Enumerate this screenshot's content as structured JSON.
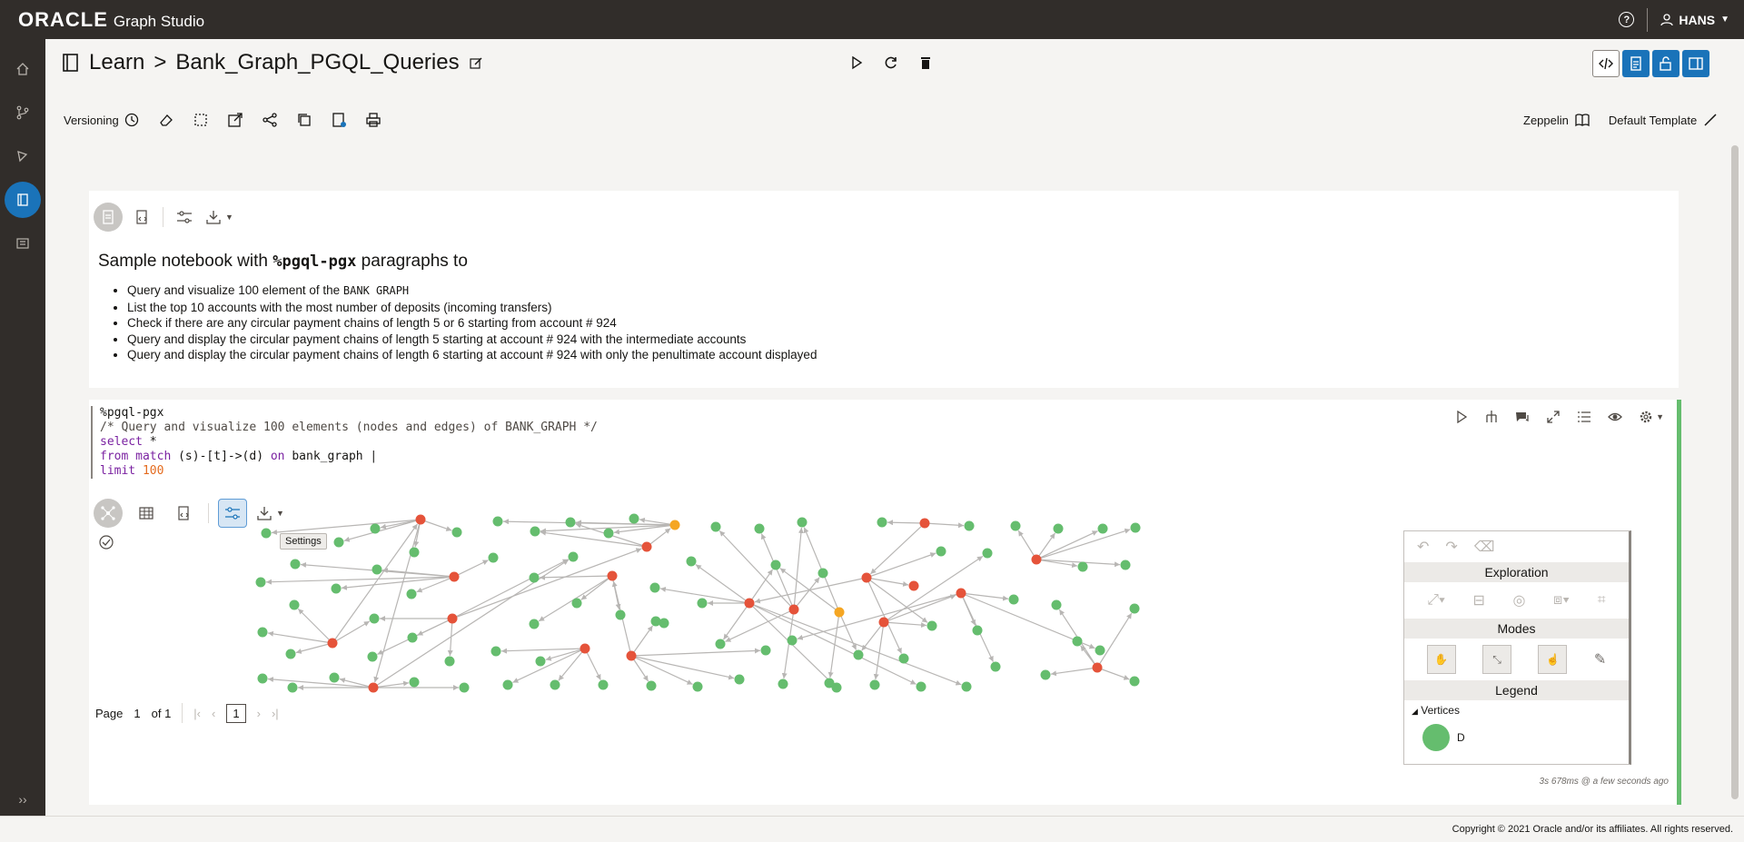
{
  "header": {
    "brand": "ORACLE",
    "product": "Graph Studio",
    "user": "HANS"
  },
  "notebook": {
    "folder": "Learn",
    "title": "Bank_Graph_PGQL_Queries"
  },
  "toolbar": {
    "versioning_label": "Versioning",
    "interpreter_label": "Zeppelin",
    "template_label": "Default Template"
  },
  "para1": {
    "heading_prefix": "Sample notebook with ",
    "heading_code": "%pgql-pgx",
    "heading_suffix": " paragraphs to",
    "items": [
      {
        "text": "Query and visualize 100 element of the ",
        "code": "BANK GRAPH"
      },
      {
        "text": "List the top 10 accounts with the most number of deposits (incoming transfers)",
        "code": ""
      },
      {
        "text": "Check if there are any circular payment chains of length 5 or 6 starting from account # 924",
        "code": ""
      },
      {
        "text": "Query and display the circular payment chains of length 5 starting at account # 924 with the intermediate accounts",
        "code": ""
      },
      {
        "text": "Query and display the circular payment chains of length 6 starting at account # 924 with only the penultimate account displayed",
        "code": ""
      }
    ]
  },
  "para2": {
    "code_line1": "%pgql-pgx",
    "code_line2": "/* Query and visualize 100 elements (nodes and edges) of BANK_GRAPH */",
    "code_select": "select",
    "code_star": " *",
    "code_from": "from",
    "code_match": " match",
    "code_pattern": " (s)-[t]->(d) ",
    "code_on": "on",
    "code_graph": " bank_graph |",
    "code_limit": "limit",
    "code_limit_val": " 100",
    "tooltip": "Settings",
    "timing": "3s 678ms @ a few seconds ago"
  },
  "panel": {
    "exploration": "Exploration",
    "modes": "Modes",
    "legend": "Legend",
    "vertices": "Vertices",
    "legend_item": "D"
  },
  "pager": {
    "page_label": "Page",
    "page_value": "1",
    "of_label": "of 1",
    "current": "1"
  },
  "footer": {
    "copyright": "Copyright © 2021 Oracle and/or its affiliates. All rights reserved."
  },
  "graph_colors": {
    "green": "#65bd6e",
    "red": "#e5533a",
    "orange": "#f5a623",
    "edge": "#b8b6b4"
  }
}
